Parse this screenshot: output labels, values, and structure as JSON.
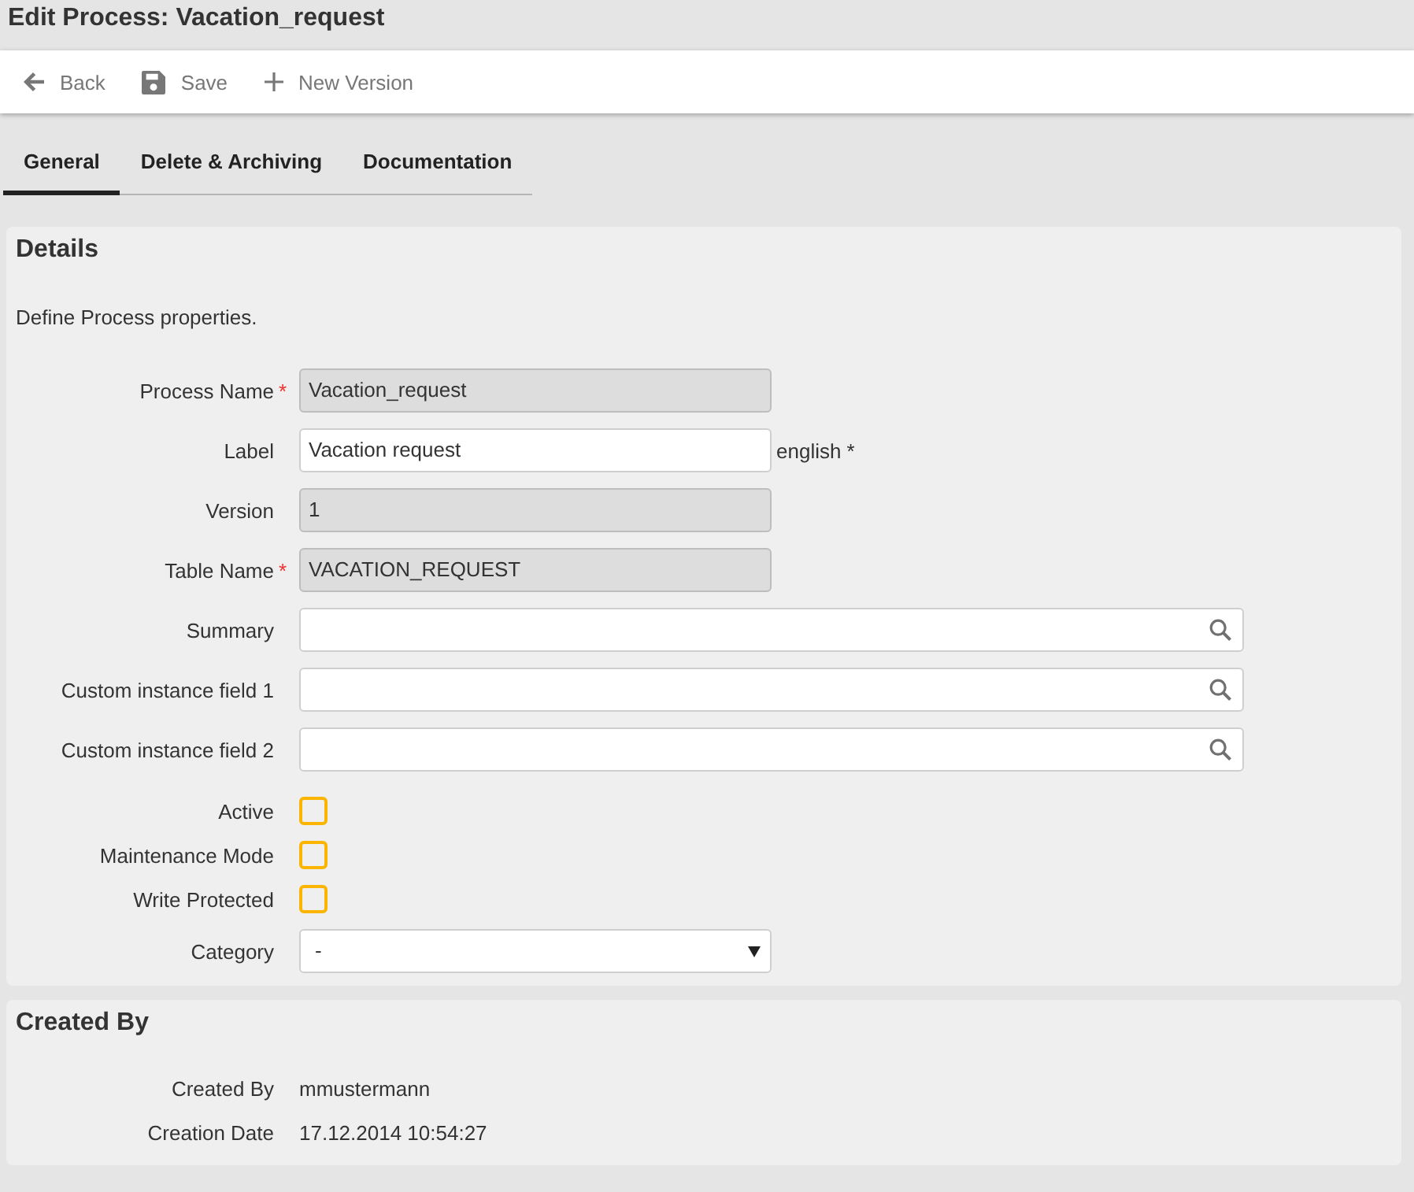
{
  "window": {
    "title": "Edit Process: Vacation_request"
  },
  "toolbar": [
    {
      "kind": "back",
      "label": "Back"
    },
    {
      "kind": "save",
      "label": "Save"
    },
    {
      "kind": "new",
      "label": "New Version"
    }
  ],
  "tabs": [
    {
      "label": "General",
      "selected": true
    },
    {
      "label": "Delete & Archiving",
      "selected": false
    },
    {
      "label": "Documentation",
      "selected": false
    }
  ],
  "details": {
    "title": "Details",
    "description": "Define Process properties.",
    "fields": [
      {
        "kind": "text",
        "label": "Process Name",
        "required_mark": "*",
        "readonly": true,
        "value": "Vacation_request"
      },
      {
        "kind": "text",
        "label": "Label",
        "readonly": false,
        "value": "Vacation request",
        "suffix": "english *"
      },
      {
        "kind": "text",
        "label": "Version",
        "readonly": true,
        "value": "1"
      },
      {
        "kind": "text",
        "label": "Table Name",
        "required_mark": "*",
        "readonly": true,
        "value": "VACATION_REQUEST"
      },
      {
        "kind": "lookup",
        "label": "Summary"
      },
      {
        "kind": "lookup",
        "label": "Custom instance field 1"
      },
      {
        "kind": "lookup",
        "label": "Custom instance field 2"
      },
      {
        "kind": "checkbox",
        "label": "Active",
        "checked": false
      },
      {
        "kind": "checkbox",
        "label": "Maintenance Mode",
        "checked": false
      },
      {
        "kind": "checkbox",
        "label": "Write Protected",
        "checked": false
      },
      {
        "kind": "select",
        "label": "Category",
        "value": "-"
      }
    ]
  },
  "created": {
    "title": "Created By",
    "rows": [
      {
        "label": "Created By",
        "value": "mmustermann"
      },
      {
        "label": "Creation Date",
        "value": "17.12.2014 10:54:27"
      }
    ]
  }
}
